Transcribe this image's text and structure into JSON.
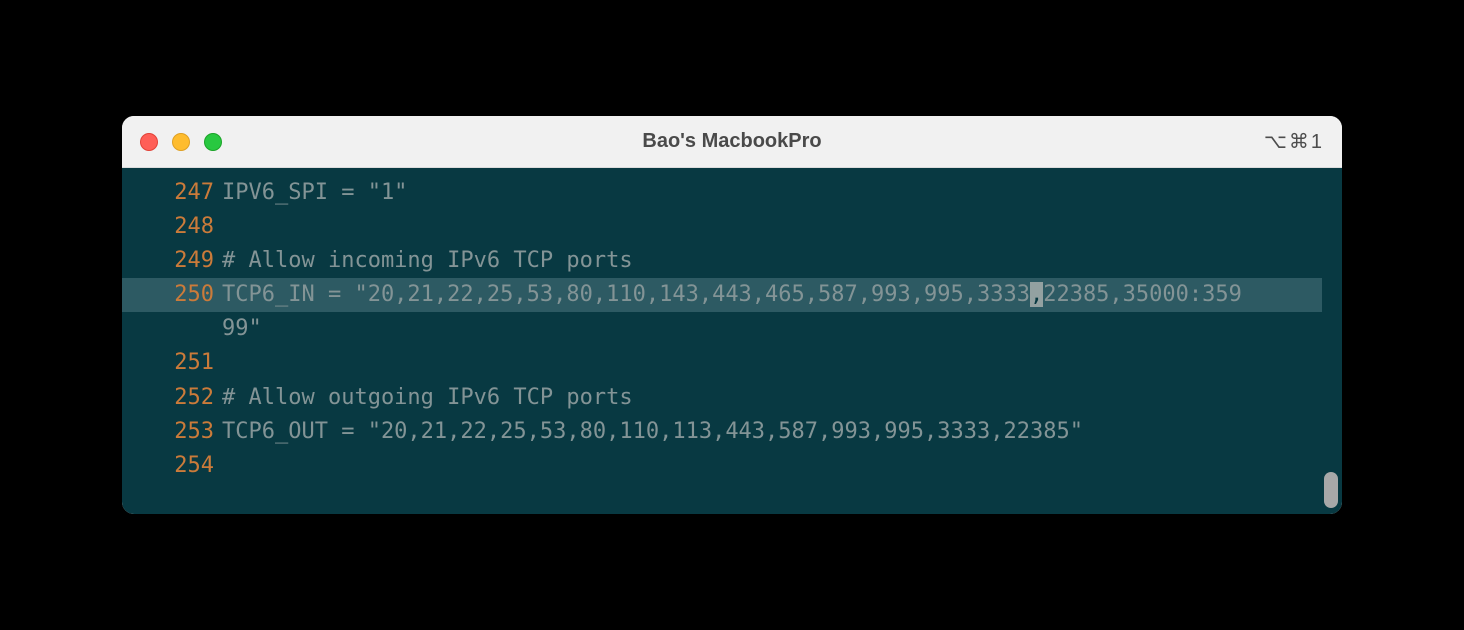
{
  "window": {
    "title": "Bao's MacbookPro",
    "shortcut": "⌥⌘1"
  },
  "lines": {
    "l247": {
      "num": "247",
      "text": "IPV6_SPI = \"1\""
    },
    "l248": {
      "num": "248",
      "text": ""
    },
    "l249": {
      "num": "249",
      "text": "# Allow incoming IPv6 TCP ports"
    },
    "l250a": {
      "num": "250",
      "pre": "TCP6_IN = \"20,21,22,25,53,80,110,143,443,465,587,993,995,3333",
      "cursor": ",",
      "post": "22385,35000:359"
    },
    "l250b": {
      "num": "",
      "text": "99\""
    },
    "l251": {
      "num": "251",
      "text": ""
    },
    "l252": {
      "num": "252",
      "text": "# Allow outgoing IPv6 TCP ports"
    },
    "l253": {
      "num": "253",
      "text": "TCP6_OUT = \"20,21,22,25,53,80,110,113,443,587,993,995,3333,22385\""
    },
    "l254": {
      "num": "254",
      "text": ""
    }
  }
}
